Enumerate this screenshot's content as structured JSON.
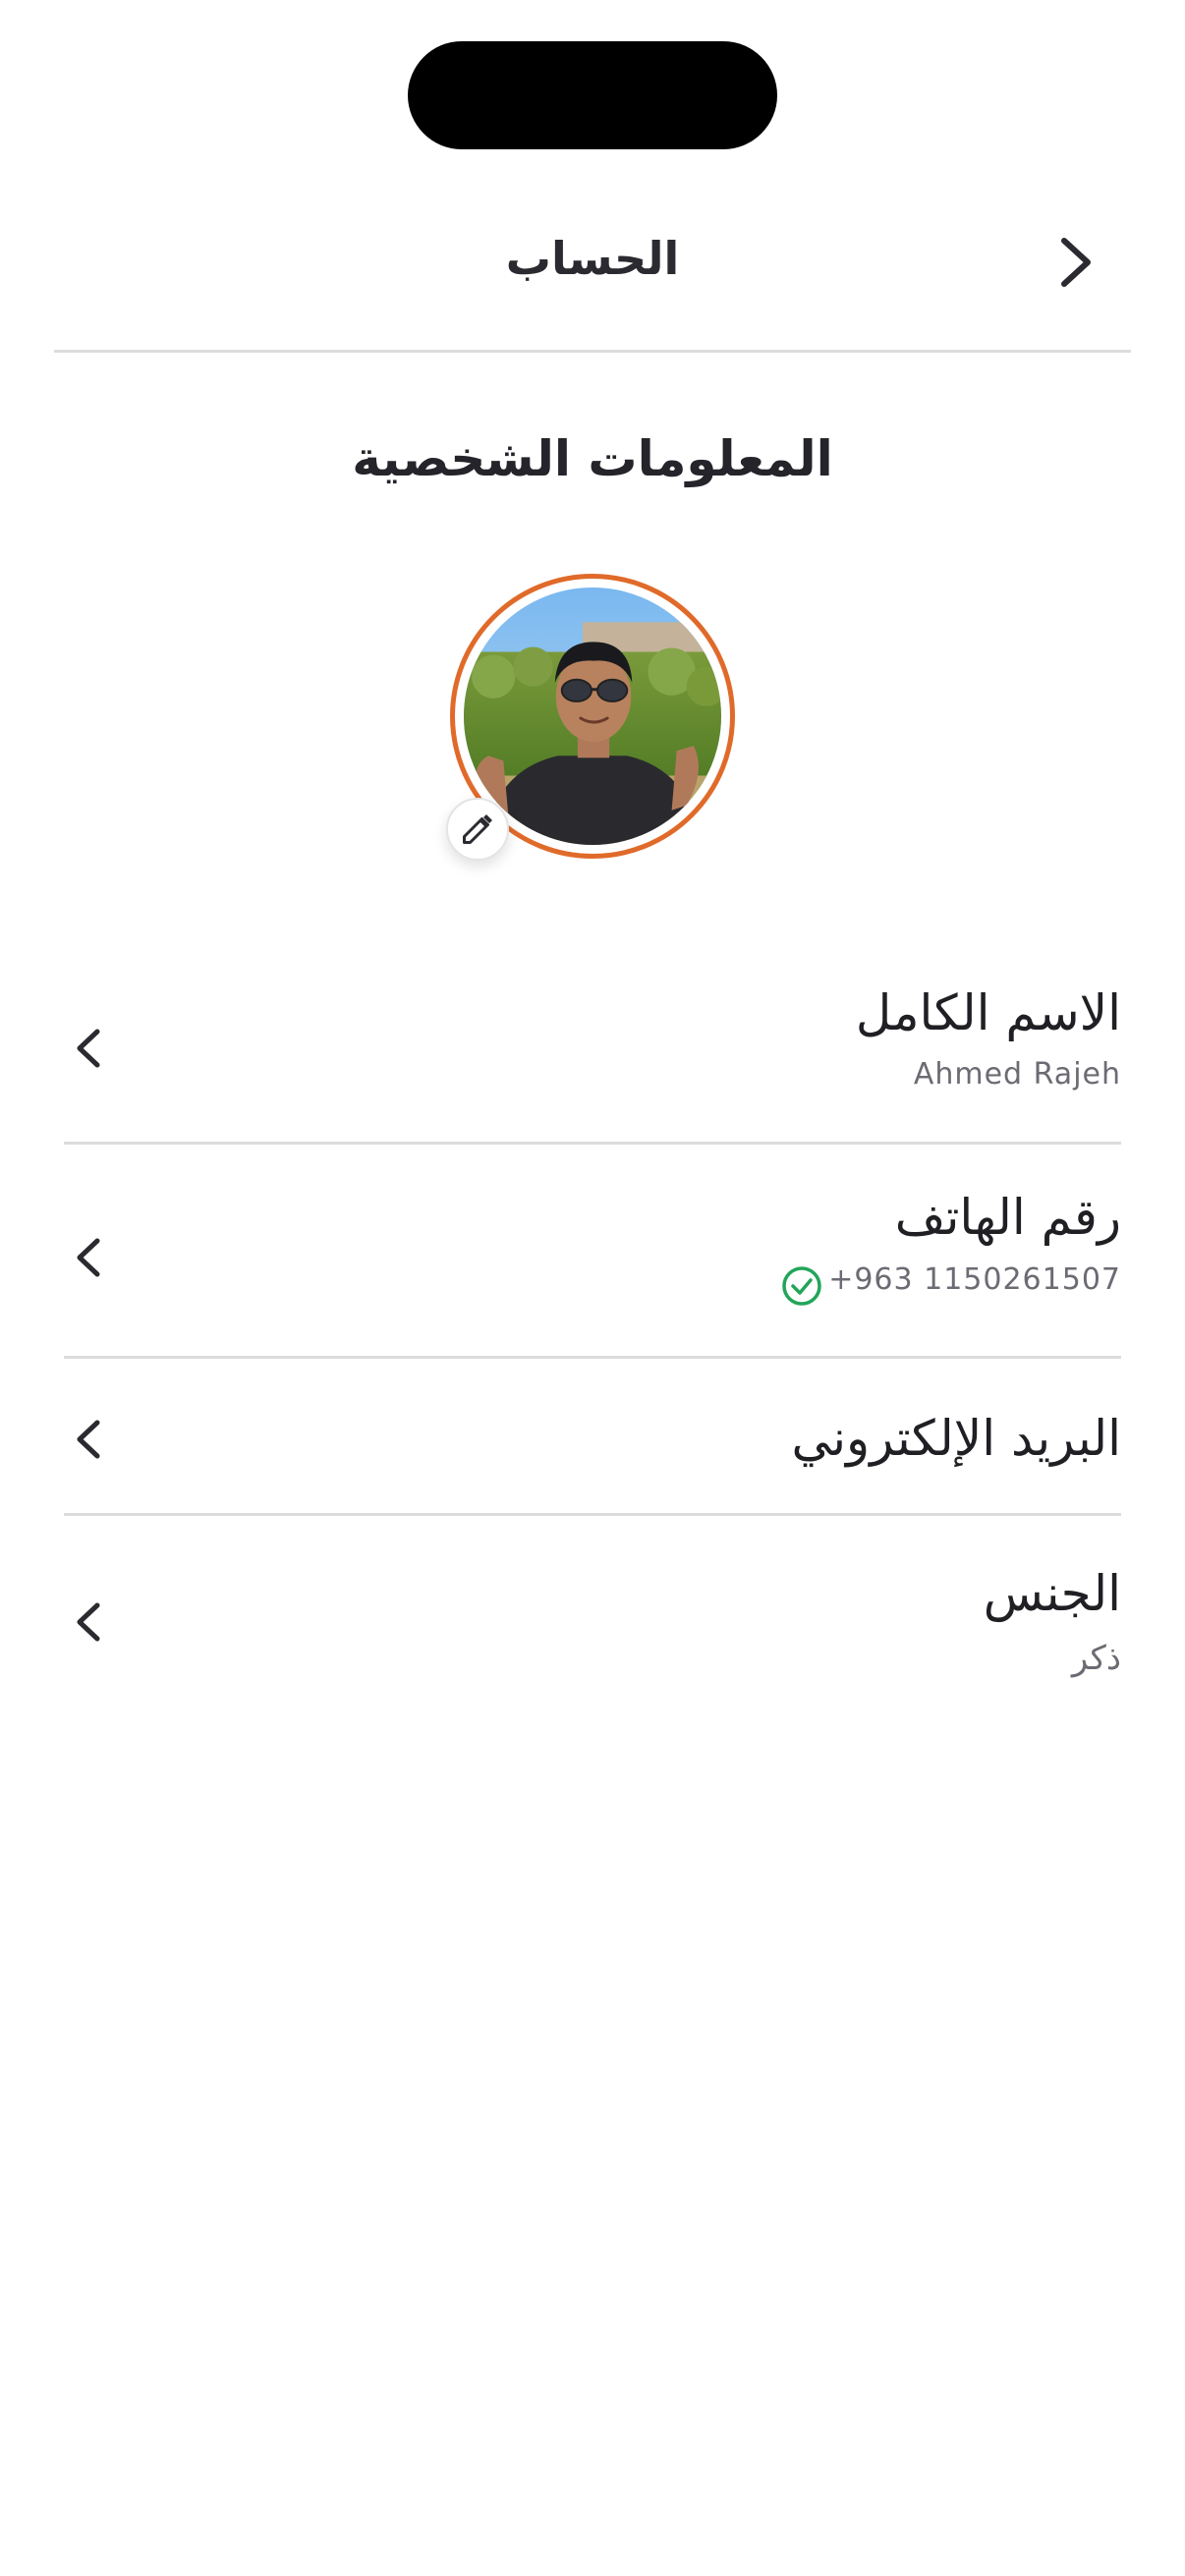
{
  "header": {
    "title": "الحساب"
  },
  "section": {
    "title": "المعلومات الشخصية"
  },
  "profile": {
    "ring_color": "#e06a2a",
    "edit_icon": "pencil-icon"
  },
  "fields": {
    "full_name": {
      "label": "الاسم الكامل",
      "value": "Ahmed Rajeh"
    },
    "phone": {
      "label": "رقم الهاتف",
      "value": "+963 1150261507",
      "verified_color": "#22a55a"
    },
    "email": {
      "label": "البريد الإلكتروني"
    },
    "gender": {
      "label": "الجنس",
      "value": "ذكر"
    }
  }
}
